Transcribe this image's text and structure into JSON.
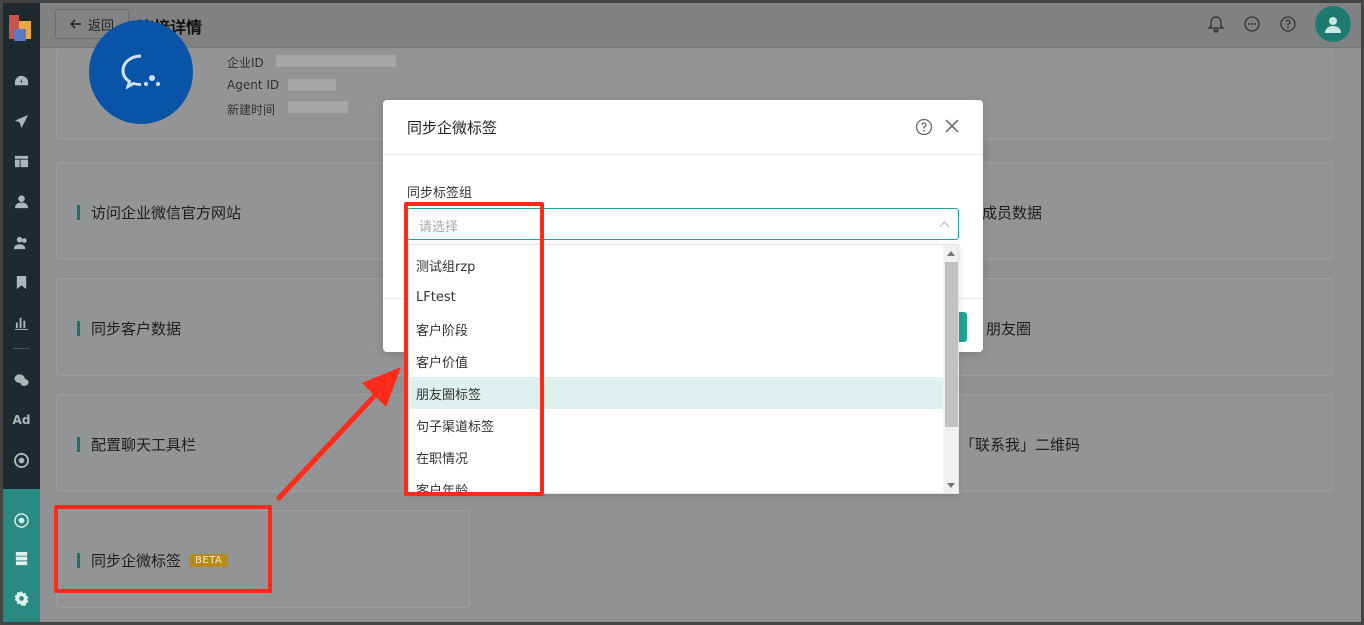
{
  "header": {
    "back_label": "返回",
    "title": "连接详情"
  },
  "profile": {
    "corp_id_label": "企业ID",
    "agent_id_label": "Agent ID",
    "created_label": "新建时间"
  },
  "cards": {
    "visit_site": "访问企业微信官方网站",
    "sync_member": "成员数据",
    "sync_customer": "同步客户数据",
    "moments": "朋友圈",
    "chat_toolbar": "配置聊天工具栏",
    "contact_qr": "「联系我」二维码",
    "sync_tags": "同步企微标签",
    "beta": "BETA"
  },
  "modal": {
    "title": "同步企微标签",
    "field_label": "同步标签组",
    "placeholder": "请选择"
  },
  "dropdown": {
    "options": [
      "测试组rzp",
      "LFtest",
      "客户阶段",
      "客户价值",
      "朋友圈标签",
      "句子渠道标签",
      "在职情况",
      "客户年龄"
    ],
    "highlighted": "朋友圈标签"
  },
  "sidebar": {
    "ad_label": "Ad"
  },
  "colors": {
    "accent": "#20a596",
    "annotation": "#ff2a1a",
    "sidebar": "#1f2a30"
  }
}
